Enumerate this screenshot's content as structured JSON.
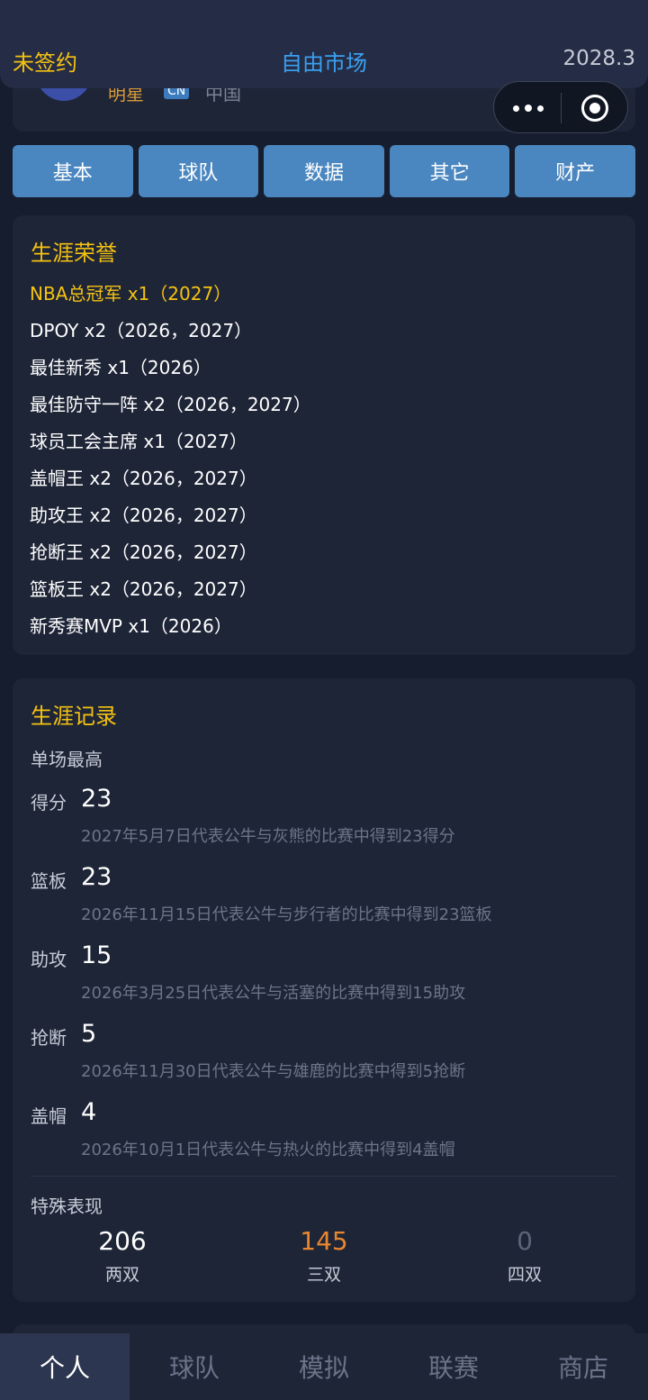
{
  "header": {
    "contract_status": "未签约",
    "market": "自由市场",
    "date": "2028.3"
  },
  "player": {
    "name": "明星",
    "flag": "CN",
    "country": "中国"
  },
  "tabs": [
    "基本",
    "球队",
    "数据",
    "其它",
    "财产"
  ],
  "honors": {
    "title": "生涯荣誉",
    "items": [
      "NBA总冠军 x1（2027）",
      "DPOY x2（2026，2027）",
      "最佳新秀 x1（2026）",
      "最佳防守一阵 x2（2026，2027）",
      "球员工会主席 x1（2027）",
      "盖帽王 x2（2026，2027）",
      "助攻王 x2（2026，2027）",
      "抢断王 x2（2026，2027）",
      "篮板王 x2（2026，2027）",
      "新秀赛MVP x1（2026）"
    ]
  },
  "records": {
    "title": "生涯记录",
    "single_game_title": "单场最高",
    "items": [
      {
        "label": "得分",
        "value": "23",
        "desc": "2027年5月7日代表公牛与灰熊的比赛中得到23得分"
      },
      {
        "label": "篮板",
        "value": "23",
        "desc": "2026年11月15日代表公牛与步行者的比赛中得到23篮板"
      },
      {
        "label": "助攻",
        "value": "15",
        "desc": "2026年3月25日代表公牛与活塞的比赛中得到15助攻"
      },
      {
        "label": "抢断",
        "value": "5",
        "desc": "2026年11月30日代表公牛与雄鹿的比赛中得到5抢断"
      },
      {
        "label": "盖帽",
        "value": "4",
        "desc": "2026年10月1日代表公牛与热火的比赛中得到4盖帽"
      }
    ],
    "special_title": "特殊表现",
    "special": [
      {
        "value": "206",
        "label": "两双",
        "color": "#ffffff"
      },
      {
        "value": "145",
        "label": "三双",
        "color": "#e8872f"
      },
      {
        "value": "0",
        "label": "四双",
        "color": "#5d6478"
      }
    ]
  },
  "bottom_nav": [
    "个人",
    "球队",
    "模拟",
    "联赛",
    "商店"
  ],
  "colors": {
    "accent_gold": "#f5c211",
    "accent_blue": "#3aa0f0",
    "tab_blue": "#4a86bf"
  }
}
